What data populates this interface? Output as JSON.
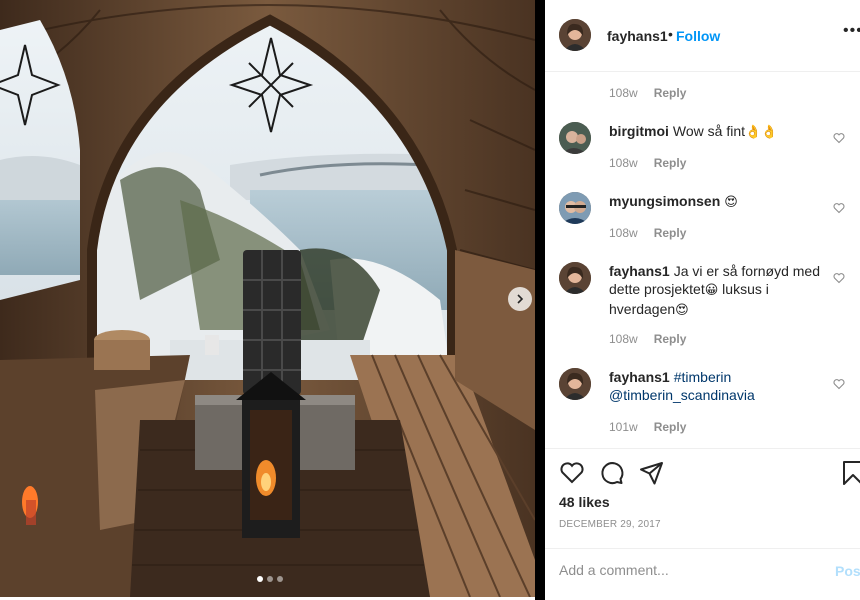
{
  "post": {
    "username": "fayhans1",
    "separator": "•",
    "follow_label": "Follow",
    "more_label": "•••",
    "image_alt": "Sauna interior with arched window overlooking snowy fjord",
    "carousel": {
      "total": 3,
      "active": 1
    }
  },
  "top_meta": {
    "time": "108w",
    "reply": "Reply"
  },
  "comments": [
    {
      "username": "birgitmoi",
      "text": "Wow så fint",
      "emoji": "👌👌",
      "time": "108w",
      "reply": "Reply"
    },
    {
      "username": "myungsimonsen",
      "text": "",
      "emoji": "😍",
      "time": "108w",
      "reply": "Reply"
    },
    {
      "username": "fayhans1",
      "text": "Ja vi er så fornøyd med dette prosjektet",
      "emoji": "😀",
      "text2": " luksus i hverdagen",
      "emoji2": "😍",
      "time": "108w",
      "reply": "Reply"
    },
    {
      "username": "fayhans1",
      "text": "#timberin",
      "text2": "@timberin_scandinavia",
      "time": "101w",
      "reply": "Reply"
    }
  ],
  "likes": "48 likes",
  "date": "December 29, 2017",
  "add_comment": {
    "placeholder": "Add a comment...",
    "post_label": "Post"
  },
  "colors": {
    "link": "#0095f6",
    "mention": "#00376b",
    "muted": "#8e8e8e"
  }
}
